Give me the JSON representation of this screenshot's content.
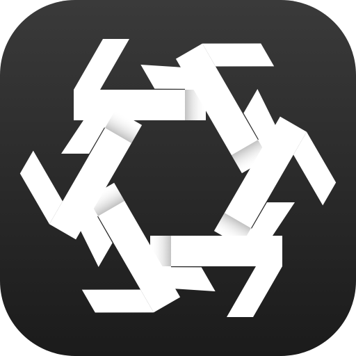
{
  "app_icon": {
    "name": "snowflake-app-icon",
    "background_color_top": "#3a3a3a",
    "background_color_bottom": "#1b1b1b",
    "glyph_color": "#ffffff",
    "glyph_shadow_color": "#bfbfbf",
    "glyph_arms": 6
  }
}
